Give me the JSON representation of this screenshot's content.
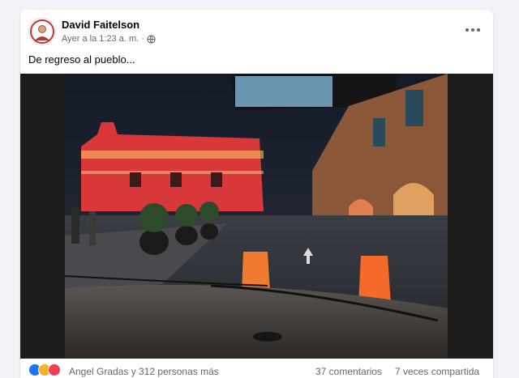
{
  "post": {
    "author": "David Faitelson",
    "timestamp": "Ayer a la 1:23 a. m.",
    "separator": "·",
    "privacy_icon": "globe-icon",
    "caption": "De regreso al pueblo...",
    "menu_icon": "more-options-icon"
  },
  "footer": {
    "reactions": [
      "like-icon",
      "haha-icon",
      "love-icon"
    ],
    "reactions_text": "Angel Gradas y 312 personas más",
    "comments": "37 comentarios",
    "shares": "7 veces compartida"
  },
  "colors": {
    "brand_blue": "#1877f2",
    "text_primary": "#050505",
    "text_secondary": "#65676b",
    "background": "#f0f2f5"
  }
}
